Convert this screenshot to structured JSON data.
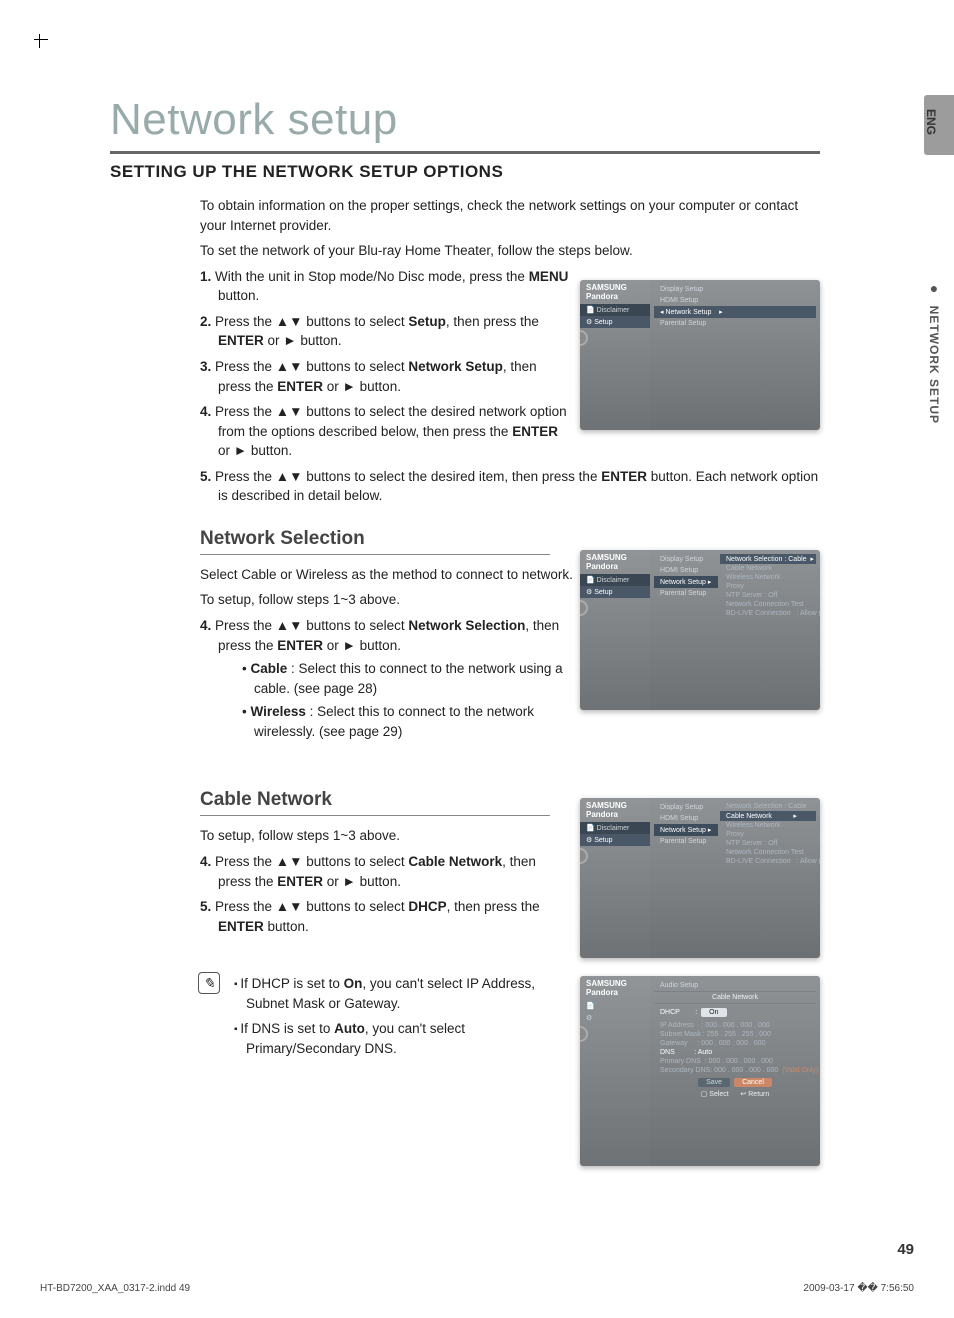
{
  "langTab": "ENG",
  "sideLabel": "NETWORK SETUP",
  "h1": "Network setup",
  "h2": "SETTING UP THE NETWORK SETUP OPTIONS",
  "intro1": "To obtain information on the proper settings, check the network settings on your computer or contact your Internet provider.",
  "intro2": "To set the network of your Blu-ray Home Theater, follow the steps below.",
  "steps": {
    "s1_a": "With the unit in Stop mode/No Disc mode, press the ",
    "s1_b": "MENU",
    "s1_c": " button.",
    "s2_a": "Press the ▲▼ buttons to select ",
    "s2_b": "Setup",
    "s2_c": ", then press the ",
    "s2_d": "ENTER",
    "s2_e": " or ► button.",
    "s3_a": "Press the ▲▼ buttons to select ",
    "s3_b": "Network Setup",
    "s3_c": ", then press the ",
    "s3_d": "ENTER",
    "s3_e": " or ► button.",
    "s4_a": "Press the ▲▼ buttons to select the desired network option from the options described below, then press the ",
    "s4_b": "ENTER",
    "s4_c": " or ► button.",
    "s5_a": "Press the ▲▼ buttons to select the desired item, then press the ",
    "s5_b": "ENTER",
    "s5_c": " button. Each network option is described in detail below."
  },
  "netsel": {
    "title": "Network Selection",
    "p1": "Select Cable or Wireless as the method to connect to network.",
    "p2": "To setup, follow steps 1~3 above.",
    "s4_a": "Press the ▲▼ buttons to select ",
    "s4_b": "Network Selection",
    "s4_c": ", then press the ",
    "s4_d": "ENTER",
    "s4_e": " or ► button.",
    "cable_b": "Cable",
    "cable_t": " : Select this to connect to the network using a cable. (see page 28)",
    "wire_b": "Wireless",
    "wire_t": " : Select this to connect to the network wirelessly. (see page 29)"
  },
  "cablenet": {
    "title": "Cable Network",
    "p1": "To setup, follow steps 1~3 above.",
    "s4_a": "Press the ▲▼ buttons to select ",
    "s4_b": "Cable Network",
    "s4_c": ", then press the ",
    "s4_d": "ENTER",
    "s4_e": " or ► button.",
    "s5_a": "Press the ▲▼ buttons to select ",
    "s5_b": "DHCP",
    "s5_c": ", then press the ",
    "s5_d": "ENTER",
    "s5_e": " button."
  },
  "notes": {
    "n1_a": "If DHCP is set to ",
    "n1_b": "On",
    "n1_c": ", you can't select IP Address, Subnet Mask or Gateway.",
    "n2_a": "If DNS is set to ",
    "n2_b": "Auto",
    "n2_c": ", you can't select Primary/Secondary DNS."
  },
  "shots": {
    "brand": "SAMSUNG",
    "pandora": "Pandora",
    "disclaimer": "Disclaimer",
    "setup": "Setup",
    "menu": {
      "display": "Display Setup",
      "hdmi": "HDMI Setup",
      "network": "Network Setup",
      "parental": "Parental Setup",
      "audio": "Audio Setup"
    },
    "items": {
      "netsel": "Network Selection :  Cable",
      "cablenet": "Cable Network",
      "wireless": "Wireless Network",
      "proxy": "Proxy",
      "ntp": "NTP Server           : Off",
      "conntest": "Network Connection Test",
      "bdlive": "BD-LIVE Connection",
      "bdlive_val": ": Allow (Valid Only)"
    },
    "cable": {
      "title": "Cable Network",
      "dhcp": "DHCP",
      "on": "On",
      "ip": "IP Address",
      "ip_v": "000 . 000 . 000 . 000",
      "subnet": "Subnet Mask",
      "subnet_v": "255 . 255 . 255 . 000",
      "gateway": "Gateway",
      "gateway_v": "000 . 000 . 000 . 000",
      "dns": "DNS",
      "auto": "Auto",
      "pdns": "Primary DNS",
      "pdns_v": "000 . 000 . 000 . 000",
      "sdns": "Secondary DNS",
      "sdns_v": "000 . 000 . 000 . 000",
      "save": "Save",
      "cancel": "Cancel",
      "select": "Select",
      "return": "Return",
      "valid": "(Valid Only)"
    }
  },
  "pagenum": "49",
  "footerLeft": "HT-BD7200_XAA_0317-2.indd   49",
  "footerRight": "2009-03-17   �� 7:56:50"
}
